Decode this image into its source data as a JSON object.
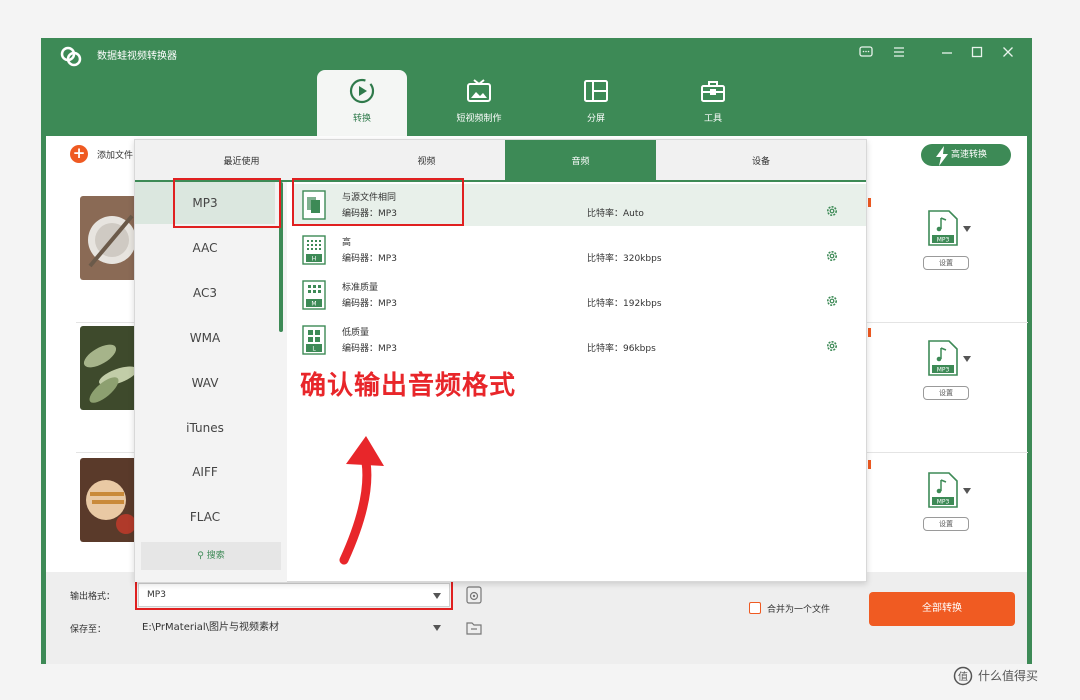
{
  "app": {
    "title": "数据蛙视频转换器"
  },
  "nav": [
    {
      "label": "转换",
      "icon": "convert-icon"
    },
    {
      "label": "短视频制作",
      "icon": "tv-icon"
    },
    {
      "label": "分屏",
      "icon": "split-screen-icon"
    },
    {
      "label": "工具",
      "icon": "toolbox-icon"
    }
  ],
  "toolbar": {
    "add_label": "添加文件",
    "high_speed_label": "高速转换"
  },
  "file_rows": [
    {
      "format": "MP3",
      "settings_label": "设置"
    },
    {
      "format": "MP3",
      "settings_label": "设置"
    },
    {
      "format": "MP3",
      "settings_label": "设置"
    }
  ],
  "popup": {
    "tabs": [
      "最近使用",
      "视频",
      "音频",
      "设备"
    ],
    "active_tab": "音频",
    "formats": [
      "MP3",
      "AAC",
      "AC3",
      "WMA",
      "WAV",
      "iTunes",
      "AIFF",
      "FLAC"
    ],
    "selected_format": "MP3",
    "search_label": "搜索",
    "qualities": [
      {
        "title": "与源文件相同",
        "codec": "编码器：MP3",
        "bitrate": "比特率：Auto",
        "badge": ""
      },
      {
        "title": "高",
        "codec": "编码器：MP3",
        "bitrate": "比特率：320kbps",
        "badge": "H"
      },
      {
        "title": "标准质量",
        "codec": "编码器：MP3",
        "bitrate": "比特率：192kbps",
        "badge": "M"
      },
      {
        "title": "低质量",
        "codec": "编码器：MP3",
        "bitrate": "比特率：96kbps",
        "badge": "L"
      }
    ]
  },
  "annotation": "确认输出音频格式",
  "bottom": {
    "output_label": "输出格式：",
    "output_value": "MP3",
    "save_label": "保存至：",
    "save_path": "E:\\PrMaterial\\图片与视频素材",
    "merge_label": "合并为一个文件",
    "convert_all_label": "全部转换"
  },
  "watermark": "什么值得买",
  "colors": {
    "brand_green": "#3d8a56",
    "accent_orange": "#f05b22",
    "annotation_red": "#e02020"
  }
}
